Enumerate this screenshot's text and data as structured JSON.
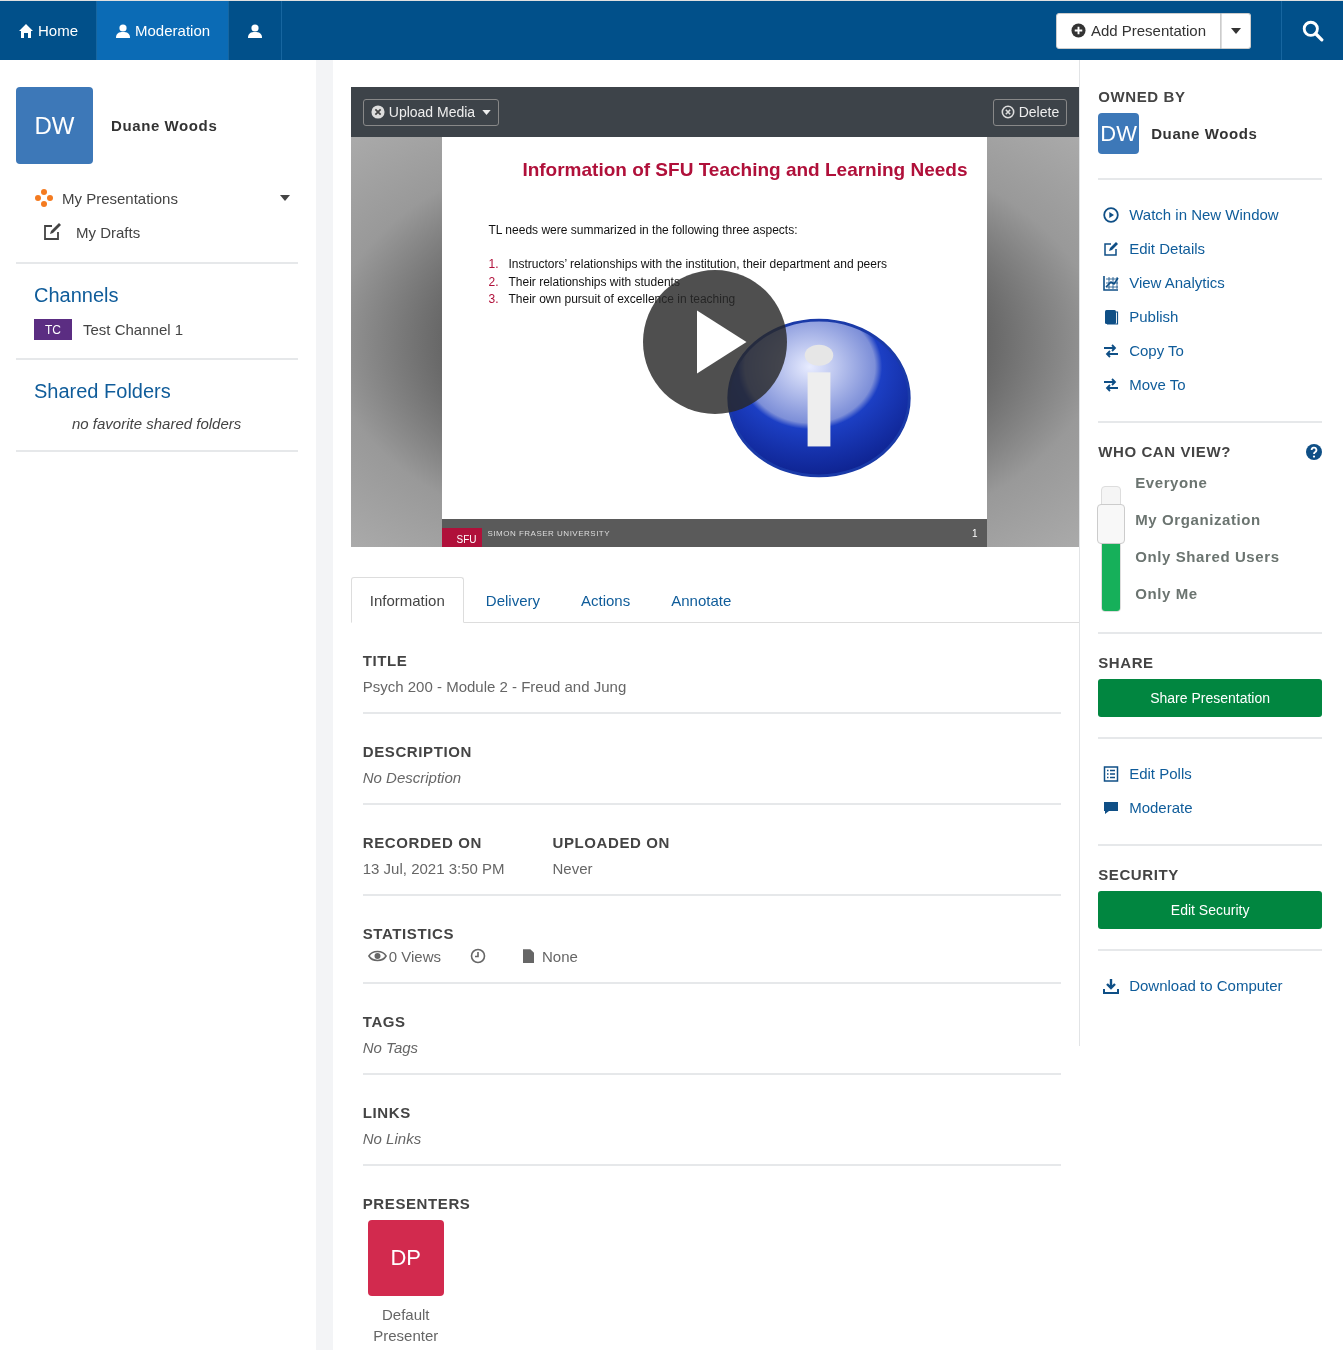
{
  "topbar": {
    "nav": [
      {
        "label": "Home",
        "selected": false
      },
      {
        "label": "Moderation",
        "selected": true
      },
      {
        "selected": false
      }
    ],
    "add_button": "Add Presentation"
  },
  "sidebar": {
    "user": {
      "initials": "DW",
      "name": "Duane Woods"
    },
    "items": [
      {
        "label": "My Presentations",
        "expandable": true
      },
      {
        "label": "My Drafts",
        "expandable": false
      }
    ],
    "channels_title": "Channels",
    "channels": [
      {
        "badge": "TC",
        "name": "Test Channel 1",
        "color": "#5b2d82"
      }
    ],
    "shared_title": "Shared Folders",
    "shared_empty": "no favorite shared folders"
  },
  "player": {
    "upload": "Upload Media",
    "delete": "Delete",
    "slide": {
      "title": "Information of SFU Teaching and Learning Needs",
      "intro": "TL needs were summarized in the following three aspects:",
      "points": [
        {
          "number": "1.",
          "text": "Instructors’ relationships with the institution, their department and peers"
        },
        {
          "number": "2.",
          "text": "Their relationships with students"
        },
        {
          "number": "3.",
          "text": "Their own pursuit of excellence in teaching"
        }
      ],
      "footer_logo": "SFU",
      "footer_name": "SIMON FRASER UNIVERSITY",
      "page": "1"
    }
  },
  "tabs": [
    {
      "label": "Information",
      "selected": true
    },
    {
      "label": "Delivery",
      "selected": false
    },
    {
      "label": "Actions",
      "selected": false
    },
    {
      "label": "Annotate",
      "selected": false
    }
  ],
  "details": {
    "title": {
      "label": "TITLE",
      "value": "Psych 200 - Module 2 - Freud and Jung"
    },
    "description": {
      "label": "DESCRIPTION",
      "value": "No Description"
    },
    "recorded": {
      "label": "RECORDED ON",
      "value": "13 Jul, 2021 3:50 PM"
    },
    "uploaded": {
      "label": "UPLOADED ON",
      "value": "Never"
    },
    "statistics": {
      "label": "STATISTICS",
      "views": "0 Views",
      "files": "None"
    },
    "tags": {
      "label": "TAGS",
      "value": "No Tags"
    },
    "links": {
      "label": "LINKS",
      "value": "No Links"
    },
    "presenters": {
      "label": "PRESENTERS",
      "items": [
        {
          "initials": "DP",
          "name": "Default Presenter"
        }
      ]
    }
  },
  "aside": {
    "owned_title": "OWNED BY",
    "owner": {
      "initials": "DW",
      "name": "Duane Woods"
    },
    "actions": [
      "Watch in New Window",
      "Edit Details",
      "View Analytics",
      "Publish",
      "Copy To",
      "Move To"
    ],
    "view_title": "WHO CAN VIEW?",
    "visibility": {
      "options": [
        "Everyone",
        "My Organization",
        "Only Shared Users",
        "Only Me"
      ],
      "level": 0.7
    },
    "share_title": "SHARE",
    "share_button": "Share Presentation",
    "tools": [
      "Edit Polls",
      "Moderate"
    ],
    "security_title": "SECURITY",
    "security_button": "Edit Security",
    "download": "Download to Computer"
  }
}
